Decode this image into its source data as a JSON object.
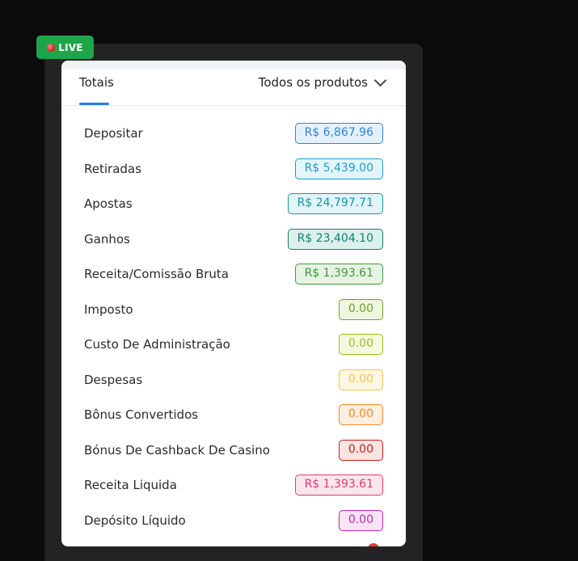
{
  "live_badge": {
    "label": "LIVE",
    "color": "#1ea449"
  },
  "header": {
    "tab_label": "Totais",
    "product_select_value": "Todos os produtos",
    "accent": "#2a7be4"
  },
  "rows": [
    {
      "label": "Depositar",
      "value": "R$ 6,867.96",
      "color": "#2b86d6",
      "bg": "#e4f1fc"
    },
    {
      "label": "Retiradas",
      "value": "R$ 5,439.00",
      "color": "#1a9fc9",
      "bg": "#e2f5fb"
    },
    {
      "label": "Apostas",
      "value": "R$ 24,797.71",
      "color": "#1796a6",
      "bg": "#e1f4f6"
    },
    {
      "label": "Ganhos",
      "value": "R$ 23,404.10",
      "color": "#0e7f6e",
      "bg": "#ddf0ec"
    },
    {
      "label": "Receita/Comissão Bruta",
      "value": "R$ 1,393.61",
      "color": "#3f9a3a",
      "bg": "#e6f4e4"
    },
    {
      "label": "Imposto",
      "value": "0.00",
      "color": "#6aa224",
      "bg": "#eef6e2"
    },
    {
      "label": "Custo De Administração",
      "value": "0.00",
      "color": "#9cbc1a",
      "bg": "#f4f8df"
    },
    {
      "label": "Despesas",
      "value": "0.00",
      "color": "#f2c44a",
      "bg": "#fdf7e3"
    },
    {
      "label": "Bônus Convertidos",
      "value": "0.00",
      "color": "#f08a2b",
      "bg": "#fdeedf"
    },
    {
      "label": "Bónus De Cashback De Casino",
      "value": "0.00",
      "color": "#c4221c",
      "bg": "#fbe3e1"
    },
    {
      "label": "Receita Liquida",
      "value": "R$ 1,393.61",
      "color": "#e23a6a",
      "bg": "#fce6ee"
    },
    {
      "label": "Depósito Líquido",
      "value": "0.00",
      "color": "#c523b0",
      "bg": "#f9e4f6"
    }
  ]
}
